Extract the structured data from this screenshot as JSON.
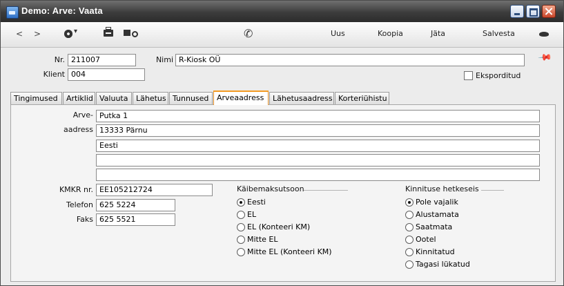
{
  "window": {
    "title": "Demo: Arve: Vaata"
  },
  "toolbar": {
    "prev": "<",
    "next": ">",
    "gear_icon": "gear-icon",
    "print_icon": "printer-icon",
    "print_preview_icon": "print-preview-icon",
    "phone_icon": "phone-icon",
    "new_label": "Uus",
    "copy_label": "Koopia",
    "skip_label": "Jäta",
    "save_label": "Salvesta",
    "eye_icon": "eye-icon"
  },
  "header": {
    "nr_label": "Nr.",
    "nr_value": "211007",
    "name_label": "Nimi",
    "name_value": "R-Kiosk OÜ",
    "client_label": "Klient",
    "client_value": "004",
    "exported_label": "Eksporditud"
  },
  "tabs": [
    {
      "label": "Tingimused",
      "active": false
    },
    {
      "label": "Artiklid",
      "active": false
    },
    {
      "label": "Valuuta",
      "active": false
    },
    {
      "label": "Lähetus",
      "active": false
    },
    {
      "label": "Tunnused",
      "active": false
    },
    {
      "label": "Arveaadress",
      "active": true
    },
    {
      "label": "Lähetusaadress",
      "active": false
    },
    {
      "label": "Korteriühistu",
      "active": false
    }
  ],
  "address": {
    "label_line1": "Arve-",
    "label_line2": "aadress",
    "lines": [
      "Putka 1",
      "13333 Pärnu",
      "Eesti",
      "",
      ""
    ]
  },
  "contact": {
    "vat_label": "KMKR nr.",
    "vat_value": "EE105212724",
    "phone_label": "Telefon",
    "phone_value": "625 5224",
    "fax_label": "Faks",
    "fax_value": "625 5521"
  },
  "vat_zone": {
    "title": "Käibemaksutsoon",
    "options": [
      "Eesti",
      "EL",
      "EL (Konteeri KM)",
      "Mitte EL",
      "Mitte EL (Konteeri KM)"
    ],
    "selected": 0
  },
  "confirm": {
    "title": "Kinnituse hetkeseis",
    "options": [
      "Pole vajalik",
      "Alustamata",
      "Saatmata",
      "Ootel",
      "Kinnitatud",
      "Tagasi lükatud"
    ],
    "selected": 0
  }
}
